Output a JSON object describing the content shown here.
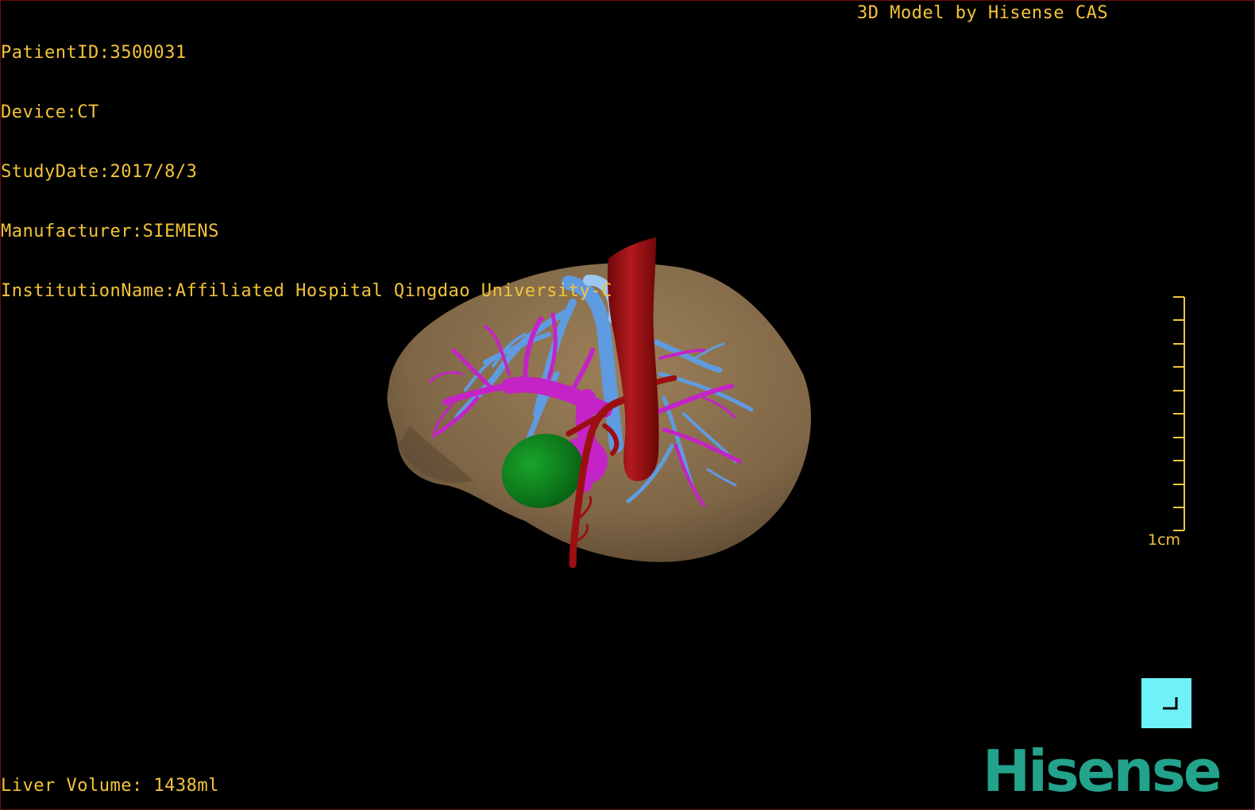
{
  "dicom_info": {
    "patient_id": "PatientID:3500031",
    "device": "Device:CT",
    "study_date": "StudyDate:2017/8/3",
    "manufacturer": "Manufacturer:SIEMENS",
    "institution": "InstitutionName:Affiliated Hospital Qingdao University-C"
  },
  "model_credit": "3D Model by Hisense CAS",
  "measurement": {
    "liver_volume": "Liver Volume: 1438ml"
  },
  "scale": {
    "label": "1cm"
  },
  "brand": {
    "logo_text": "Hisense"
  },
  "icons": {
    "reset_view": "corner-bracket-icon"
  },
  "colors": {
    "overlay_text": "#f3c43a",
    "liver": "#8a7050",
    "artery": "#9c0f12",
    "portal_vein": "#c423c7",
    "hepatic_vein": "#5f9be0",
    "gallbladder": "#0d8a1c",
    "reset_button": "#6ff2f7",
    "brand": "#23a28c"
  }
}
